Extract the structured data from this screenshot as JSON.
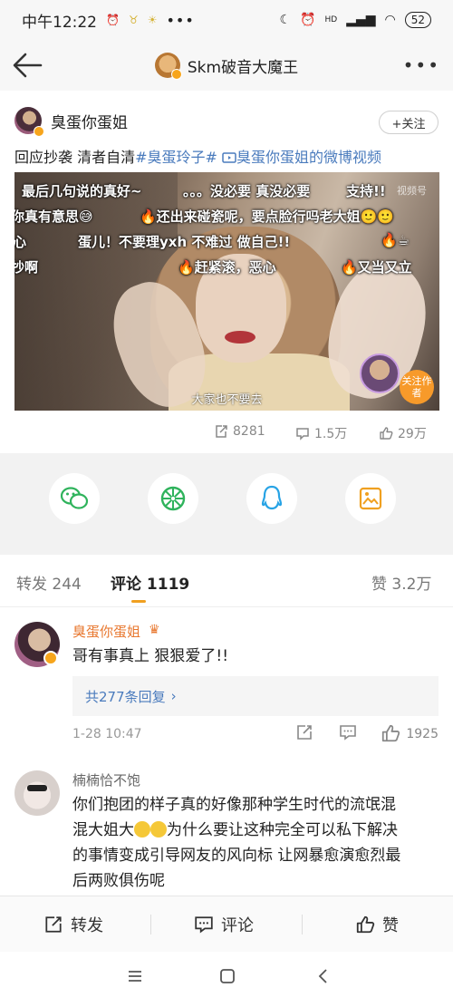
{
  "status_bar": {
    "time": "中午12:22",
    "network_label": "HD",
    "battery": "52"
  },
  "nav": {
    "title": "Skm破音大魔王"
  },
  "post": {
    "author": "臭蛋你蛋姐",
    "follow_label": "+关注",
    "text_plain": "回应抄袭 清者自清",
    "hashtag": "#臭蛋玲子#",
    "video_link": "臭蛋你蛋姐的微博视频",
    "video": {
      "danmaku": [
        "最后几句说的真好~",
        "。。。没必要 真没必要",
        "支持!!",
        "你真有意思😅",
        "🔥还出来碰瓷呢，要点脸行吗老大姐🙂🙂",
        "心",
        "蛋儿！不要理yxh 不难过 做自己!!",
        "🔥☕",
        "抄啊",
        "🔥赶紧滚，恶心",
        "🔥又当又立"
      ],
      "watermark": "视频号",
      "subtitle": "大家也不要去",
      "follow_author": "关注作者"
    },
    "stats": {
      "reposts": "8281",
      "comments": "1.5万",
      "likes": "29万"
    }
  },
  "tabs": {
    "repost": "转发 244",
    "comment": "评论 1119",
    "like": "赞 3.2万"
  },
  "comments": [
    {
      "user": "臭蛋你蛋姐",
      "text": "哥有事真上 狠狠爱了!!",
      "replies": "共277条回复",
      "time": "1-28 10:47",
      "likes": "1925"
    },
    {
      "user": "楠楠恰不饱",
      "line1": "你们抱团的样子真的好像那种学生时代的流氓混",
      "line2a": "混大姐大",
      "line2b": "为什么要让这种完全可以私下解决",
      "line3": "的事情变成引导网友的风向标 让网暴愈演愈烈最",
      "line4": "后两败俱伤呢"
    }
  ],
  "bottom_bar": {
    "repost": "转发",
    "comment": "评论",
    "like": "赞"
  },
  "colors": {
    "link_blue": "#4a7bbd",
    "accent_orange": "#f0a020",
    "name_orange": "#e8772e"
  }
}
